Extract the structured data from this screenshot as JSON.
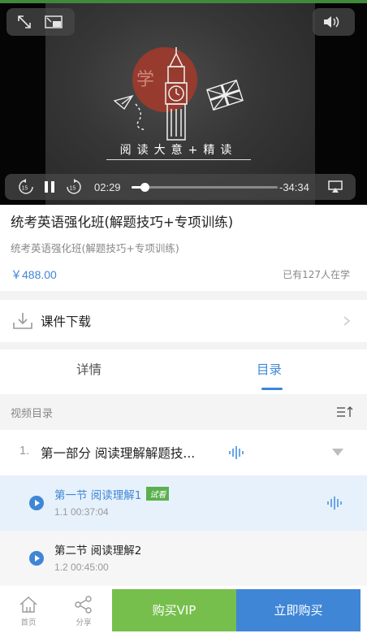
{
  "player": {
    "title_overlay": "阅读大意+精读",
    "board_char": "学",
    "current_time": "02:29",
    "remaining_time": "-34:34",
    "progress": 0.09,
    "icons": [
      "fullscreen-icon",
      "pip-icon",
      "volume-icon",
      "rewind-15-icon",
      "pause-icon",
      "forward-15-icon",
      "airplay-icon"
    ]
  },
  "course": {
    "title": "统考英语强化班(解题技巧+专项训练)",
    "subtitle": "统考英语强化班(解题技巧+专项训练)",
    "price": "￥488.00",
    "learners": "已有127人在学"
  },
  "download": {
    "label": "课件下载"
  },
  "tabs": {
    "detail": "详情",
    "catalog": "目录",
    "active": "catalog"
  },
  "catalog": {
    "header": "视频目录",
    "section": {
      "number": "1.",
      "title": "第一部分 阅读理解解题技..."
    },
    "lessons": [
      {
        "title": "第一节 阅读理解1",
        "badge": "试看",
        "meta": "1.1 00:37:04",
        "playing": true
      },
      {
        "title": "第二节 阅读理解2",
        "meta": "1.2 00:45:00",
        "playing": false
      }
    ]
  },
  "bottom": {
    "home": "首页",
    "share": "分享",
    "buy_vip": "购买VIP",
    "buy_now": "立即购买"
  },
  "colors": {
    "accent": "#3f86d6",
    "vip_green": "#76bf4c",
    "trial_badge": "#5ab04e"
  }
}
